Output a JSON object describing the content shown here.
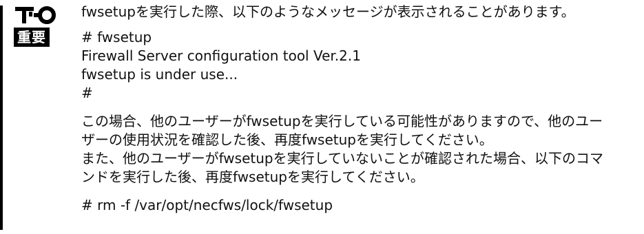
{
  "notice": {
    "label": "重要"
  },
  "intro": "fwsetupを実行した際、以下のようなメッセージが表示されることがあります。",
  "code_lines": [
    "# fwsetup",
    "Firewall Server configuration tool Ver.2.1",
    "fwsetup is under use...",
    "#"
  ],
  "paragraph1": [
    "この場合、他のユーザーがfwsetupを実行している可能性がありますので、他のユー",
    "ザーの使用状況を確認した後、再度fwsetupを実行してください。"
  ],
  "paragraph2": [
    "また、他のユーザーがfwsetupを実行していないことが確認された場合、以下のコマ",
    "ンドを実行した後、再度fwsetupを実行してください。"
  ],
  "command": "# rm -f /var/opt/necfws/lock/fwsetup"
}
